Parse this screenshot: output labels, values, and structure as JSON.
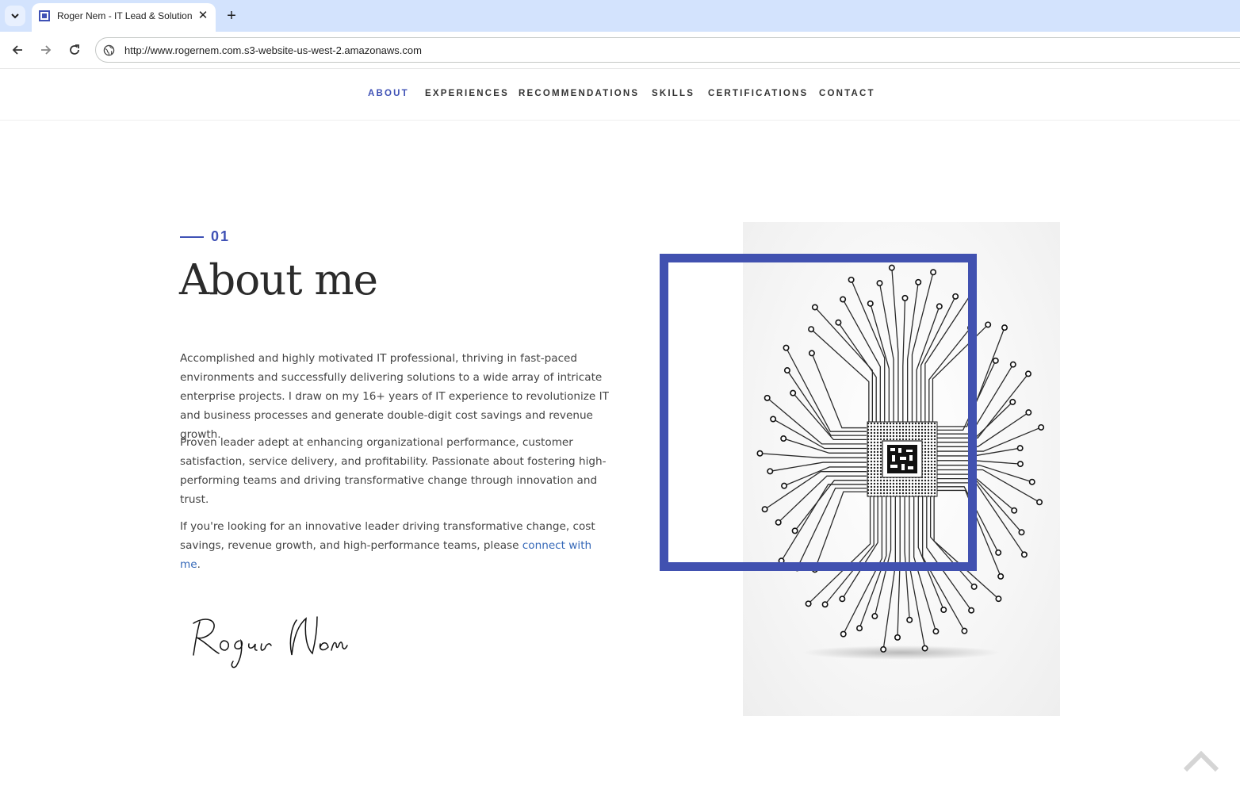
{
  "browser": {
    "tab_title": "Roger Nem - IT Lead & Solutions",
    "tab_close": "✕",
    "new_tab": "+",
    "url": "http://www.rogernem.com.s3-website-us-west-2.amazonaws.com"
  },
  "nav": {
    "items": [
      {
        "label": "ABOUT",
        "active": true
      },
      {
        "label": "EXPERIENCES",
        "active": false
      },
      {
        "label": "RECOMMENDATIONS",
        "active": false
      },
      {
        "label": "SKILLS",
        "active": false
      },
      {
        "label": "CERTIFICATIONS",
        "active": false
      },
      {
        "label": "CONTACT",
        "active": false
      }
    ]
  },
  "about": {
    "section_number": "01",
    "title": "About me",
    "paragraph_1": "Accomplished and highly motivated IT professional, thriving in fast-paced environments and successfully delivering solutions to a wide array of intricate enterprise projects. I draw on my 16+ years of IT experience to revolutionize IT and business processes and generate double-digit cost savings and revenue growth.",
    "paragraph_2": "Proven leader adept at enhancing organizational performance, customer satisfaction, service delivery, and profitability. Passionate about fostering high-performing teams and driving transformative change through innovation and trust.",
    "paragraph_3_prefix": "If you're looking for an innovative leader driving transformative change, cost savings, revenue growth, and high-performance teams, please ",
    "paragraph_3_link": "connect with me",
    "paragraph_3_suffix": ".",
    "signature": "Roger Nem"
  },
  "colors": {
    "accent": "#3f51b5",
    "frame": "#4151b0",
    "link": "#3568b8",
    "tabstrip": "#d3e3fd"
  },
  "icons": {
    "tab_list": "chevron-down-icon",
    "favicon": "site-favicon-icon",
    "back": "back-arrow-icon",
    "forward": "forward-arrow-icon",
    "reload": "reload-icon",
    "site_info": "site-info-icon",
    "scroll_top": "chevron-up-icon",
    "illustration": "circuit-brain-chip-illustration"
  }
}
